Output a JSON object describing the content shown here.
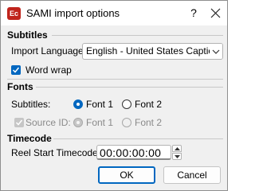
{
  "window": {
    "title": "SAMI import options",
    "app_icon_text": "Ec",
    "help_label": "?"
  },
  "subtitles": {
    "heading": "Subtitles",
    "import_language_label": "Import Language:",
    "import_language_value": "English - United States Captions",
    "word_wrap_label": "Word wrap",
    "word_wrap_checked": true
  },
  "fonts": {
    "heading": "Fonts",
    "subtitles_label": "Subtitles:",
    "font1_label": "Font 1",
    "font2_label": "Font 2",
    "subtitles_selected": "Font 1",
    "source_id_label": "Source ID:",
    "source_font1_label": "Font 1",
    "source_font2_label": "Font 2",
    "source_id_checked": true,
    "source_id_enabled": false
  },
  "timecode": {
    "heading": "Timecode",
    "reel_start_label": "Reel Start Timecode:",
    "reel_start_value": "00:00:00:00"
  },
  "buttons": {
    "ok": "OK",
    "cancel": "Cancel"
  },
  "colors": {
    "accent": "#0067c0",
    "app_icon": "#c0241c",
    "disabled_text": "#8a8a8a"
  }
}
